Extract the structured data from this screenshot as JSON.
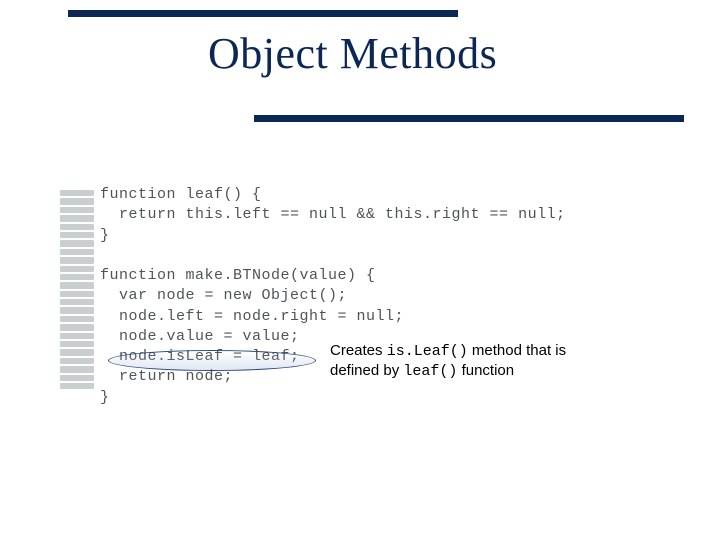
{
  "title": "Object Methods",
  "code": {
    "line1": "function leaf() {",
    "line2": "  return this.left == null && this.right == null;",
    "line3": "}",
    "line4": "",
    "line5": "function make.BTNode(value) {",
    "line6": "  var node = new Object();",
    "line7": "  node.left = node.right = null;",
    "line8": "  node.value = value;",
    "line9": "  node.isLeaf = leaf;",
    "line10": "  return node;",
    "line11": "}"
  },
  "callout": {
    "t1": "Creates ",
    "m1": "is.Leaf()",
    "t2": " method that is defined by ",
    "m2": "leaf()",
    "t3": " function"
  }
}
